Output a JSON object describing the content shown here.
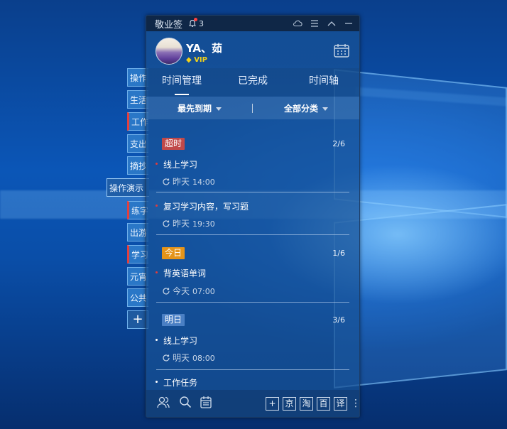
{
  "desktop": {
    "side_tabs": [
      {
        "label": "操作"
      },
      {
        "label": "生活"
      },
      {
        "label": "工作"
      },
      {
        "label": "支出"
      },
      {
        "label": "摘抄"
      },
      {
        "label": "操作演示"
      },
      {
        "label": "练字"
      },
      {
        "label": "出游"
      },
      {
        "label": "学习"
      },
      {
        "label": "元宵"
      },
      {
        "label": "公共"
      }
    ],
    "add_label": "+"
  },
  "titlebar": {
    "app_name": "敬业签",
    "notification_count": "3",
    "icons": [
      "cloud-icon",
      "menu-icon",
      "collapse-icon",
      "minimize-icon"
    ]
  },
  "profile": {
    "username": "YA、茹",
    "vip_label": "VIP"
  },
  "tabs": [
    {
      "label": "时间管理"
    },
    {
      "label": "已完成"
    },
    {
      "label": "时间轴"
    }
  ],
  "filters": {
    "sort_label": "最先到期",
    "category_label": "全部分类"
  },
  "groups": [
    {
      "badge": "超时",
      "color": "#c0494a",
      "count": "2/6",
      "tasks": [
        {
          "title": "线上学习",
          "when": "昨天",
          "time": "14:00",
          "bullet": "#e33b3b"
        },
        {
          "title": "复习学习内容，写习题",
          "when": "昨天",
          "time": "19:30",
          "bullet": "#e33b3b"
        }
      ]
    },
    {
      "badge": "今日",
      "color": "#e4941a",
      "count": "1/6",
      "tasks": [
        {
          "title": "背英语单词",
          "when": "今天",
          "time": "07:00",
          "bullet": "#e33b3b"
        }
      ]
    },
    {
      "badge": "明日",
      "color": "#4a7fc4",
      "count": "3/6",
      "tasks": [
        {
          "title": "线上学习",
          "when": "明天",
          "time": "08:00",
          "bullet": "#ffffff"
        },
        {
          "title": "工作任务",
          "bullet": "#ffffff"
        }
      ]
    }
  ],
  "bottombar": {
    "left_icons": [
      "contacts-icon",
      "search-icon",
      "calendar-list-icon"
    ],
    "right_buttons": [
      {
        "label": "+"
      },
      {
        "label": "京"
      },
      {
        "label": "淘"
      },
      {
        "label": "百"
      },
      {
        "label": "译"
      }
    ]
  }
}
